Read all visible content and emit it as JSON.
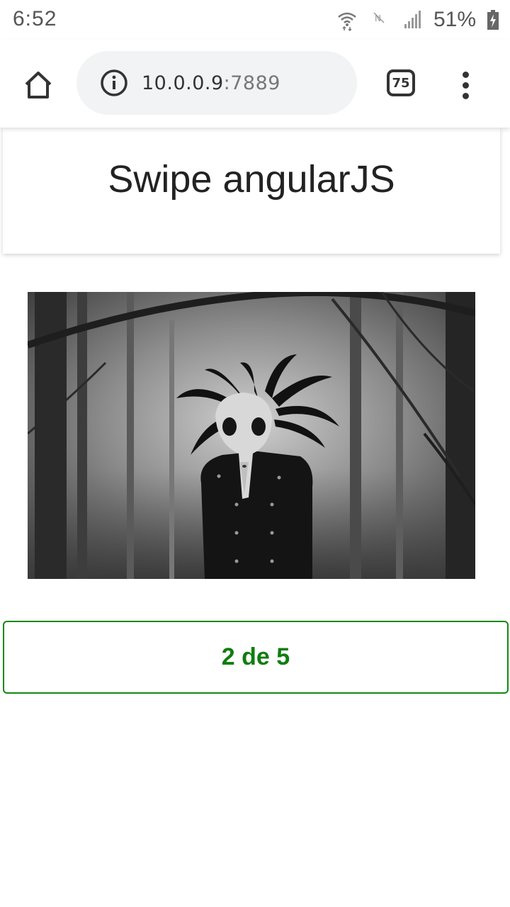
{
  "status_bar": {
    "time": "6:52",
    "battery_percent": "51%",
    "icons": [
      "wifi-icon",
      "mute-icon",
      "signal-icon",
      "battery-charging-icon"
    ]
  },
  "browser": {
    "url_host": "10.0.0.9",
    "url_port": ":7889",
    "tab_count": "75",
    "icons": [
      "home-icon",
      "info-icon",
      "tabs-icon",
      "more-vert-icon"
    ],
    "colors": {
      "url_field_bg": "#f1f3f4"
    }
  },
  "page": {
    "title": "Swipe angularJS",
    "counter": "2 de 5",
    "colors": {
      "counter_text": "#0f7d0f",
      "counter_border": "#118811"
    }
  },
  "carousel": {
    "current_index": 2,
    "total": 5
  }
}
